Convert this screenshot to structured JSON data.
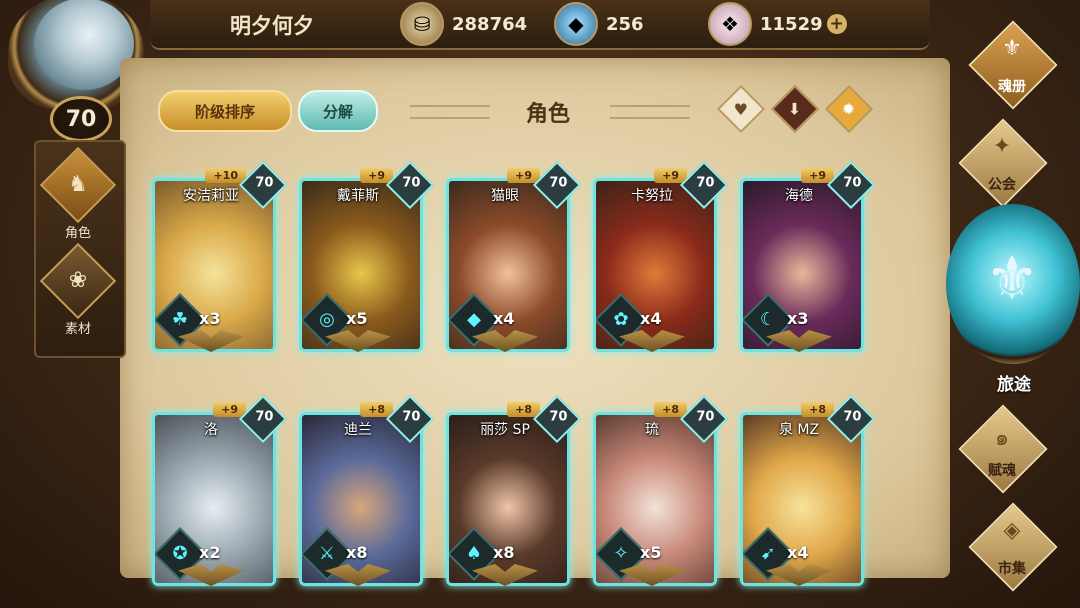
{
  "player": {
    "name": "明夕何夕",
    "level": "70"
  },
  "currency": {
    "gold": "288764",
    "crystal": "256",
    "soul": "11529",
    "plus": "+"
  },
  "nav_left": [
    {
      "label": "角色"
    },
    {
      "label": "素材"
    }
  ],
  "header": {
    "sort_label": "阶级排序",
    "decompose_label": "分解",
    "title": "角色"
  },
  "filters": [
    "favorite-heart",
    "rank-down",
    "star-badge"
  ],
  "cards": [
    {
      "name": "安洁莉亚",
      "plus": "+10",
      "level": "70",
      "count": "x3",
      "element": "☘",
      "art": [
        "#f6e39a",
        "#d9a94a",
        "#7a5a2a"
      ]
    },
    {
      "name": "戴菲斯",
      "plus": "+9",
      "level": "70",
      "count": "x5",
      "element": "◎",
      "art": [
        "#e9c64a",
        "#8a5a1c",
        "#3a2a1a"
      ]
    },
    {
      "name": "猫眼",
      "plus": "+9",
      "level": "70",
      "count": "x4",
      "element": "◆",
      "art": [
        "#f2c09a",
        "#8b4a2a",
        "#3b2a1c"
      ]
    },
    {
      "name": "卡努拉",
      "plus": "+9",
      "level": "70",
      "count": "x4",
      "element": "✿",
      "art": [
        "#e07a3a",
        "#8a2a1a",
        "#3a2418"
      ]
    },
    {
      "name": "海德",
      "plus": "+9",
      "level": "70",
      "count": "x3",
      "element": "☾",
      "art": [
        "#e8b89a",
        "#6a2a5a",
        "#2a1a2a"
      ]
    },
    {
      "name": "洛",
      "plus": "+9",
      "level": "70",
      "count": "x2",
      "element": "✪",
      "art": [
        "#e6eef2",
        "#9aa8b0",
        "#4a5058"
      ]
    },
    {
      "name": "迪兰",
      "plus": "+8",
      "level": "70",
      "count": "x8",
      "element": "⚔",
      "art": [
        "#d9a67a",
        "#5a6a9a",
        "#2a2838"
      ]
    },
    {
      "name": "丽莎 SP",
      "plus": "+8",
      "level": "70",
      "count": "x8",
      "element": "♠",
      "art": [
        "#f0c4a8",
        "#5a3a2a",
        "#2a1e18"
      ]
    },
    {
      "name": "琉",
      "plus": "+8",
      "level": "70",
      "count": "x5",
      "element": "✧",
      "art": [
        "#f3e2d8",
        "#c88a7a",
        "#5a3a30"
      ]
    },
    {
      "name": "泉 MZ",
      "plus": "+8",
      "level": "70",
      "count": "x4",
      "element": "➹",
      "art": [
        "#f8e29a",
        "#e0a84a",
        "#5a3a22"
      ]
    }
  ],
  "nav_right": [
    {
      "label": "魂册",
      "icon": "⚜"
    },
    {
      "label": "公会",
      "icon": "✦"
    },
    {
      "label": "赋魂",
      "icon": "๑"
    },
    {
      "label": "市集",
      "icon": "◈"
    }
  ],
  "journey": {
    "label": "旅途",
    "icon": "⚜"
  }
}
